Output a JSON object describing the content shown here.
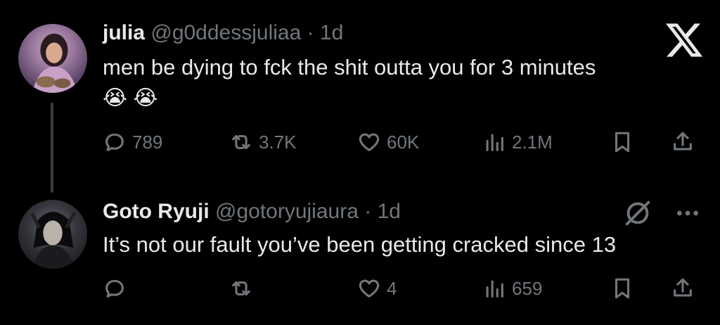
{
  "tweets": [
    {
      "name": "julia",
      "handle": "@g0ddessjuliaa",
      "dot": "·",
      "time": "1d",
      "text": "men be dying to fck the shit outta you for 3 minutes",
      "emojis": "😭 😭",
      "replies": "789",
      "reposts": "3.7K",
      "likes": "60K",
      "views": "2.1M"
    },
    {
      "name": "Goto Ryuji",
      "handle": "@gotoryujiaura",
      "dot": "·",
      "time": "1d",
      "text": "It’s not our fault you’ve been getting cracked since 13",
      "replies": "",
      "reposts": "",
      "likes": "4",
      "views": "659"
    }
  ],
  "icons": {
    "top_right": "x-logo-icon",
    "grok": "grok-icon",
    "more": "more-icon"
  }
}
